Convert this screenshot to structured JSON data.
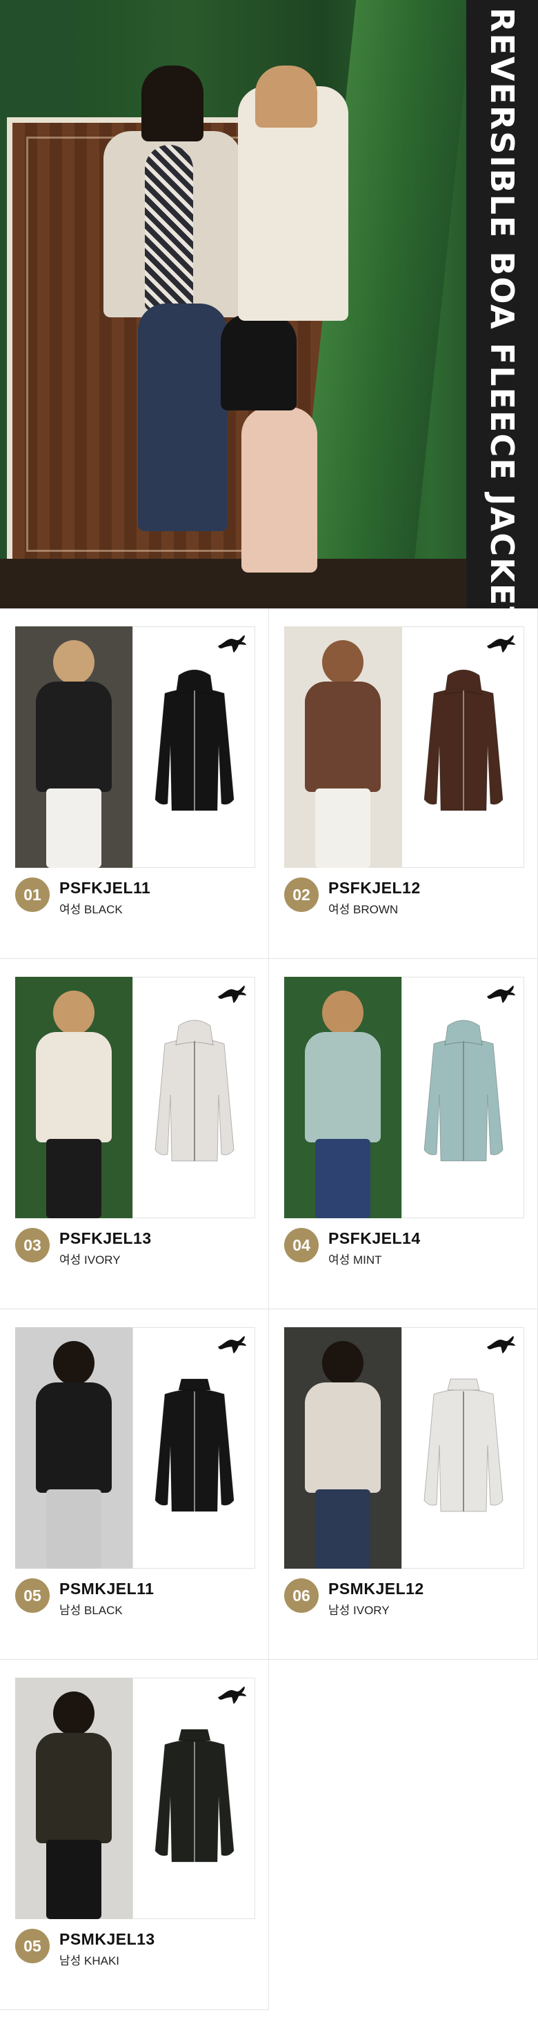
{
  "hero": {
    "title": "REVERSIBLE BOA FLEECE JACKET"
  },
  "brand_icon": "puma-logo-icon",
  "accent_color": "#a8915f",
  "products": [
    {
      "num": "01",
      "code": "PSFKJEL11",
      "label": "여성 BLACK",
      "jacket_color": "#141414",
      "model_bg": "#4d4a44",
      "model_top": "#1e1e1e",
      "model_bottom": "#f1f0ec",
      "hair": "#c9a275",
      "hood": true
    },
    {
      "num": "02",
      "code": "PSFKJEL12",
      "label": "여성 BROWN",
      "jacket_color": "#4a2a1e",
      "model_bg": "#e6e1d8",
      "model_top": "#6b4330",
      "model_bottom": "#f2f0ea",
      "hair": "#8a5a3a",
      "hood": true
    },
    {
      "num": "03",
      "code": "PSFKJEL13",
      "label": "여성 IVORY",
      "jacket_color": "#e3e0dc",
      "model_bg": "#2f5a2e",
      "model_top": "#ece5da",
      "model_bottom": "#1b1b1b",
      "hair": "#c79a6a",
      "hood": true
    },
    {
      "num": "04",
      "code": "PSFKJEL14",
      "label": "여성 MINT",
      "jacket_color": "#9dbdbd",
      "model_bg": "#2f5e31",
      "model_top": "#a9c4bf",
      "model_bottom": "#2d4270",
      "hair": "#c08f5e",
      "hood": true
    },
    {
      "num": "05",
      "code": "PSMKJEL11",
      "label": "남성 BLACK",
      "jacket_color": "#151515",
      "model_bg": "#cfcfcf",
      "model_top": "#1a1a1a",
      "model_bottom": "#c9c9c9",
      "hair": "#1b140f",
      "hood": false
    },
    {
      "num": "06",
      "code": "PSMKJEL12",
      "label": "남성 IVORY",
      "jacket_color": "#e7e5e2",
      "model_bg": "#3a3a36",
      "model_top": "#ddd7ce",
      "model_bottom": "#2c3a55",
      "hair": "#1b140f",
      "hood": false
    },
    {
      "num": "05",
      "code": "PSMKJEL13",
      "label": "남성 KHAKI",
      "jacket_color": "#1f221c",
      "model_bg": "#d8d6d2",
      "model_top": "#2e2b22",
      "model_bottom": "#151515",
      "hair": "#1b140f",
      "hood": false
    }
  ]
}
